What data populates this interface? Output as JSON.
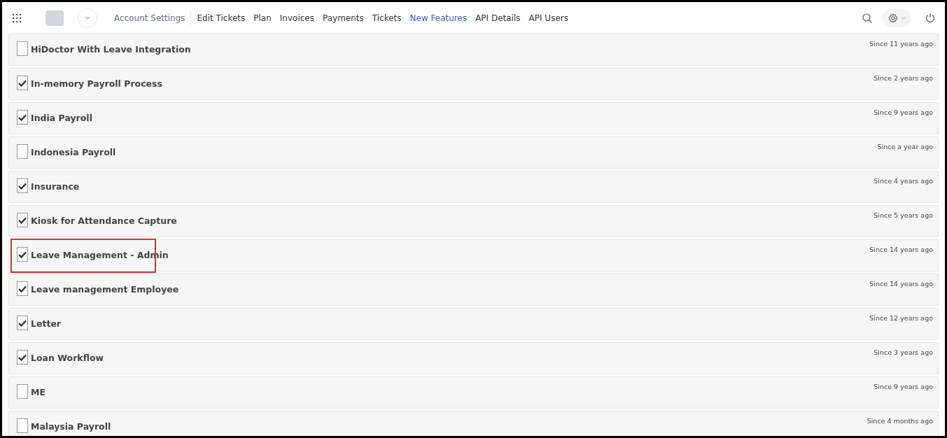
{
  "nav": {
    "links": [
      {
        "label": "Account Settings",
        "selected": false
      },
      {
        "label": "Edit Tickets",
        "selected": false
      },
      {
        "label": "Plan",
        "selected": false
      },
      {
        "label": "Invoices",
        "selected": false
      },
      {
        "label": "Payments",
        "selected": false
      },
      {
        "label": "Tickets",
        "selected": false
      },
      {
        "label": "New Features",
        "selected": true
      },
      {
        "label": "API Details",
        "selected": false
      },
      {
        "label": "API Users",
        "selected": false
      }
    ]
  },
  "features": [
    {
      "name": "HiDoctor With Leave Integration",
      "checked": false,
      "since": "Since 11 years ago",
      "highlighted": false
    },
    {
      "name": "In-memory Payroll Process",
      "checked": true,
      "since": "Since 2 years ago",
      "highlighted": false
    },
    {
      "name": "India Payroll",
      "checked": true,
      "since": "Since 9 years ago",
      "highlighted": false
    },
    {
      "name": "Indonesia Payroll",
      "checked": false,
      "since": "Since a year ago",
      "highlighted": false
    },
    {
      "name": "Insurance",
      "checked": true,
      "since": "Since 4 years ago",
      "highlighted": false
    },
    {
      "name": "Kiosk for Attendance Capture",
      "checked": true,
      "since": "Since 5 years ago",
      "highlighted": false
    },
    {
      "name": "Leave Management - Admin",
      "checked": true,
      "since": "Since 14 years ago",
      "highlighted": true
    },
    {
      "name": "Leave management Employee",
      "checked": true,
      "since": "Since 14 years ago",
      "highlighted": false
    },
    {
      "name": "Letter",
      "checked": true,
      "since": "Since 12 years ago",
      "highlighted": false
    },
    {
      "name": "Loan Workflow",
      "checked": true,
      "since": "Since 3 years ago",
      "highlighted": false
    },
    {
      "name": "ME",
      "checked": false,
      "since": "Since 9 years ago",
      "highlighted": false
    },
    {
      "name": "Malaysia Payroll",
      "checked": false,
      "since": "Since 4 months ago",
      "highlighted": false
    }
  ]
}
